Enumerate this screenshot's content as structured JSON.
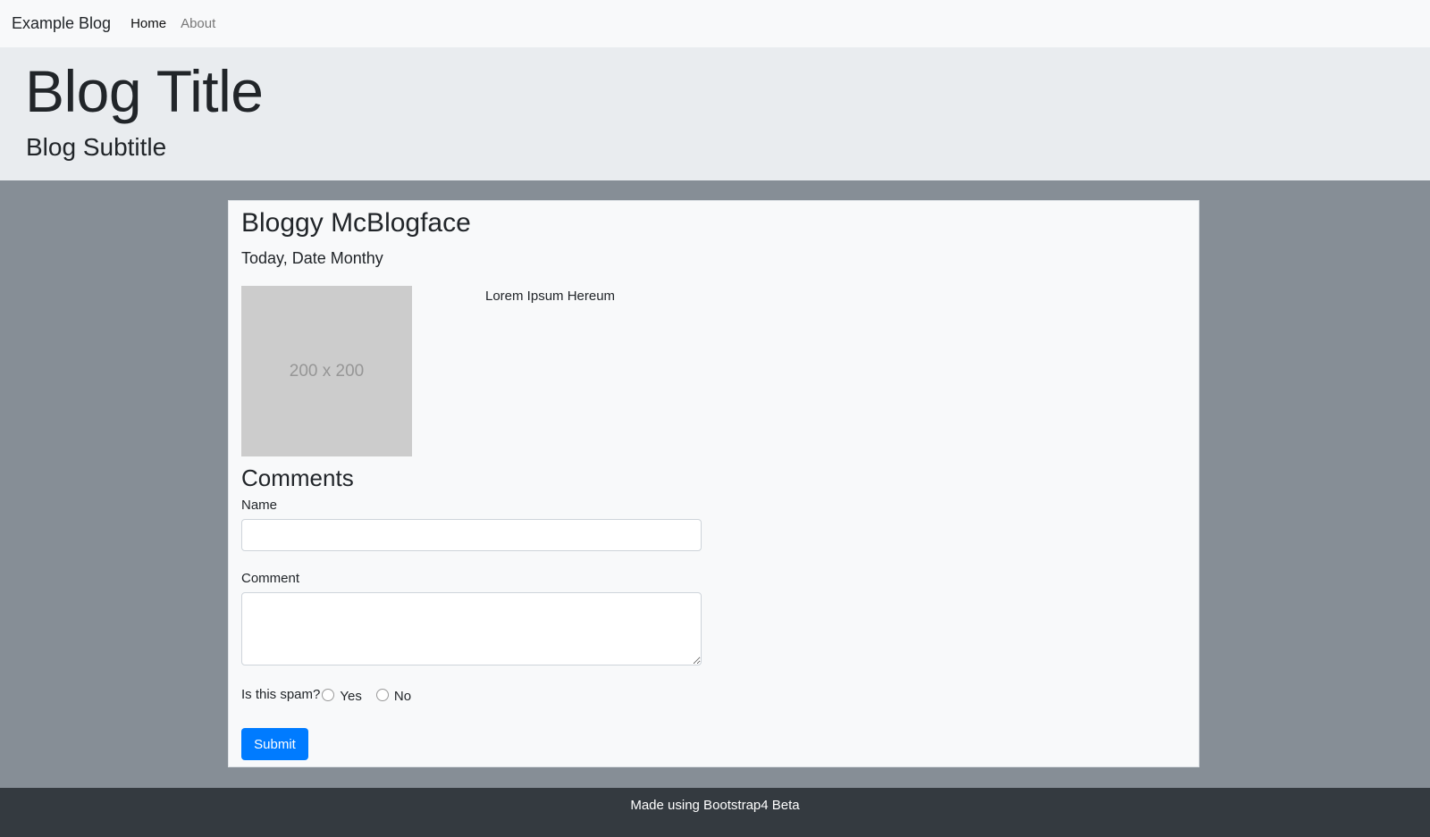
{
  "navbar": {
    "brand": "Example Blog",
    "links": [
      "Home",
      "About"
    ]
  },
  "header": {
    "title": "Blog Title",
    "subtitle": "Blog Subtitle"
  },
  "post": {
    "author": "Bloggy McBlogface",
    "date": "Today, Date Monthy",
    "image_placeholder": "200 x 200",
    "body": "Lorem Ipsum Hereum"
  },
  "comments": {
    "heading": "Comments",
    "name_label": "Name",
    "name_value": "",
    "comment_label": "Comment",
    "comment_value": "",
    "spam_question": "Is this spam?",
    "spam_options": [
      "Yes",
      "No"
    ],
    "submit_label": "Submit"
  },
  "footer": {
    "text": "Made using Bootstrap4 Beta"
  },
  "colors": {
    "primary": "#007bff",
    "navbar_bg": "#f8f9fa",
    "jumbotron_bg": "#e9ecef",
    "page_bg": "#868e96",
    "footer_bg": "#343a40"
  }
}
